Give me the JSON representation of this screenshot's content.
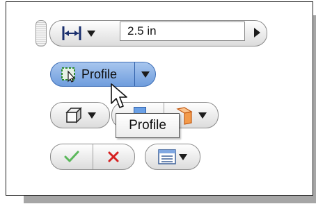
{
  "dimension": {
    "value": "2.5 in"
  },
  "profile_button": {
    "label": "Profile"
  },
  "tooltip": {
    "text": "Profile"
  },
  "icons": {
    "dimension_type": "horizontal-dimension-icon",
    "value_arrow": "play-arrow-icon",
    "profile": "profile-select-icon",
    "solid": "solid-box-icon",
    "surface": "surface-icon",
    "ok": "checkmark-icon",
    "cancel": "x-icon",
    "options": "options-list-icon",
    "cursor": "mouse-pointer-icon"
  },
  "colors": {
    "profile_fill": "#7fa7e2",
    "ok_green": "#5bb85b",
    "cancel_red": "#d62020",
    "surface_orange": "#f39a4a"
  }
}
